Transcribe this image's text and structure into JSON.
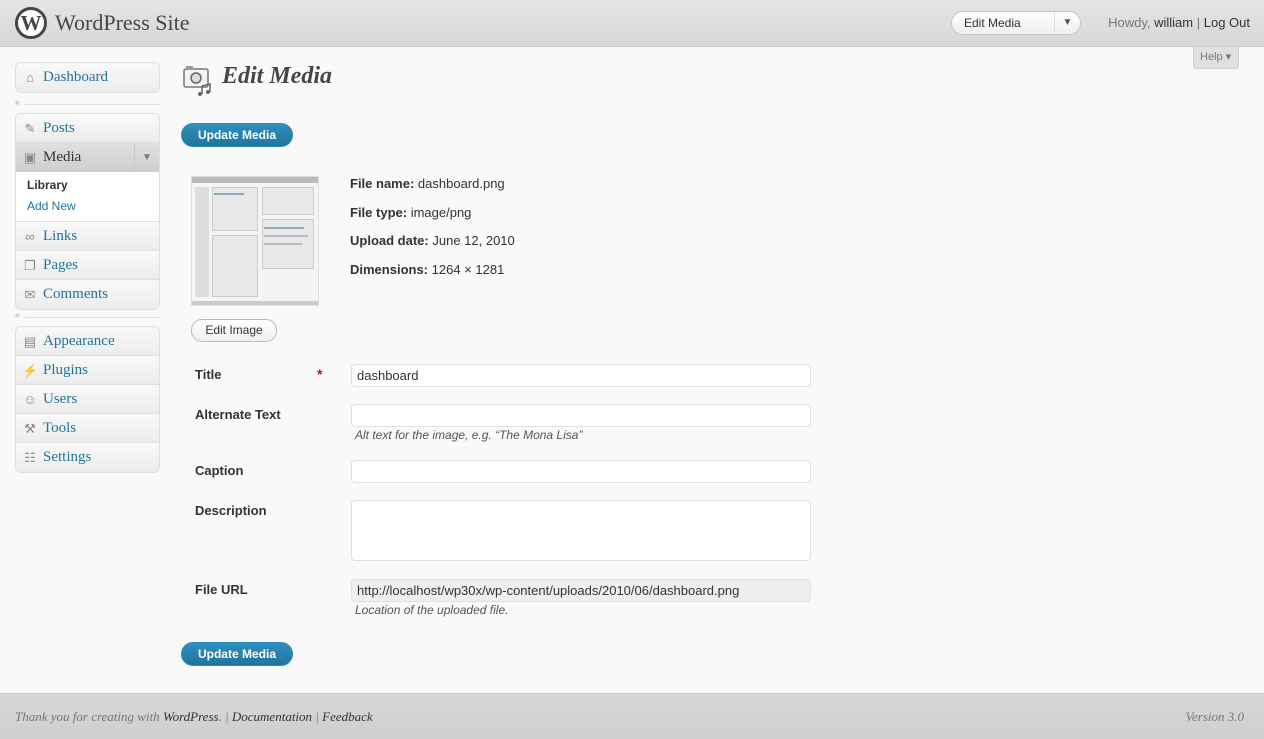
{
  "header": {
    "site_title": "WordPress Site",
    "logo_letter": "W",
    "favorite_actions": {
      "selected": "Edit Media",
      "toggle": "▼"
    },
    "howdy": "Howdy,",
    "user": "william",
    "separator": "|",
    "logout": "Log Out"
  },
  "help_tab": "Help ▾",
  "menu": {
    "dashboard": "Dashboard",
    "posts": "Posts",
    "media": "Media",
    "media_sub": [
      "Library",
      "Add New"
    ],
    "links": "Links",
    "pages": "Pages",
    "comments": "Comments",
    "appearance": "Appearance",
    "plugins": "Plugins",
    "users": "Users",
    "tools": "Tools",
    "settings": "Settings"
  },
  "page": {
    "title": "Edit Media",
    "update_button": "Update Media",
    "edit_image_button": "Edit Image"
  },
  "meta": {
    "file_name_label": "File name:",
    "file_name": "dashboard.png",
    "file_type_label": "File type:",
    "file_type": "image/png",
    "upload_date_label": "Upload date:",
    "upload_date": "June 12, 2010",
    "dimensions_label": "Dimensions:",
    "dimensions": "1264 × 1281"
  },
  "fields": {
    "title_label": "Title",
    "title_required": "*",
    "title_value": "dashboard",
    "alt_label": "Alternate Text",
    "alt_value": "",
    "alt_help": "Alt text for the image, e.g. “The Mona Lisa”",
    "caption_label": "Caption",
    "caption_value": "",
    "description_label": "Description",
    "url_label": "File URL",
    "url_value": "http://localhost/wp30x/wp-content/uploads/2010/06/dashboard.png",
    "url_help": "Location of the uploaded file."
  },
  "footer": {
    "thanks": "Thank you for creating with",
    "wordpress": "WordPress",
    "dot": ".",
    "sep1": "|",
    "documentation": "Documentation",
    "sep2": "|",
    "feedback": "Feedback",
    "version": "Version 3.0"
  }
}
